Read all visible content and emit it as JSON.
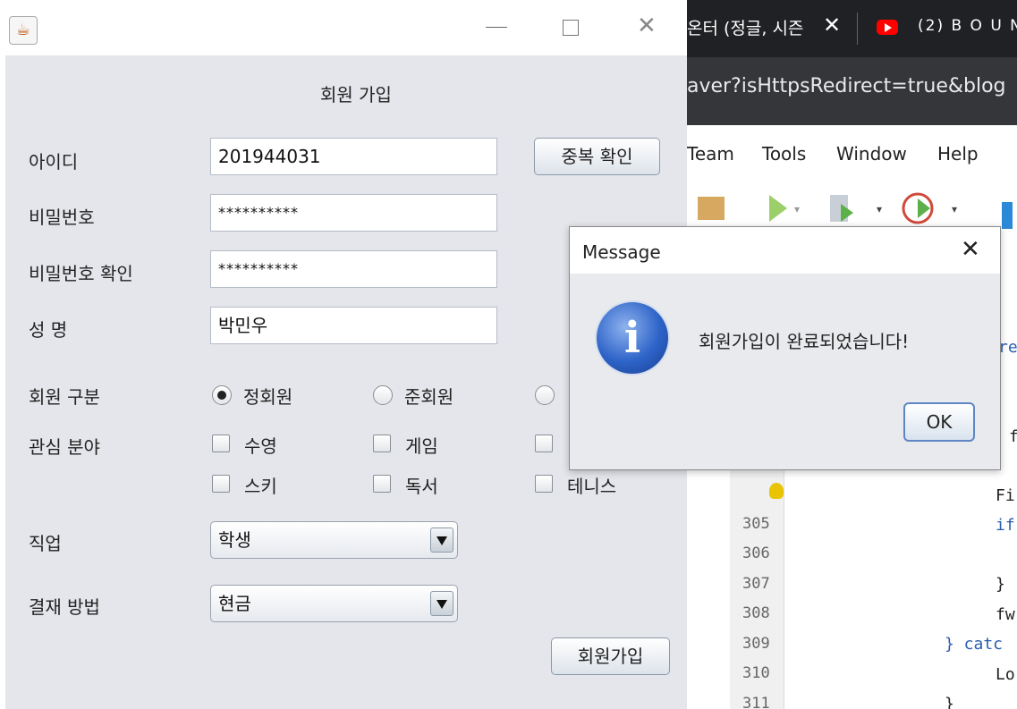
{
  "background": {
    "tab1_title": "온터 (정글, 시즌",
    "tab2_title": "(2) B O U N",
    "url": "aver?isHttpsRedirect=true&blog",
    "menu": [
      "Team",
      "Tools",
      "Window",
      "Help"
    ],
    "line_numbers": [
      "305",
      "306",
      "307",
      "308",
      "309",
      "310",
      "311"
    ],
    "code": {
      "c1": "re",
      "c2": "f",
      "c3": "Fi",
      "c4": "if",
      "c5": "}",
      "c6": "fw",
      "c7": "} catc",
      "c8": "Lo",
      "c9": "}"
    }
  },
  "form": {
    "title": "회원 가입",
    "id_label": "아이디",
    "id_value": "201944031",
    "dup_button": "중복 확인",
    "pw_label": "비밀번호",
    "pw_value": "**********",
    "pw_confirm_label": "비밀번호 확인",
    "pw_confirm_value": "**********",
    "name_label": "성 명",
    "name_value": "박민우",
    "member_type_label": "회원 구분",
    "member_types": [
      "정회원",
      "준회원"
    ],
    "member_type_selected": "정회원",
    "interest_label": "관심 분야",
    "interests": [
      "수영",
      "게임",
      "스키",
      "독서",
      "테니스"
    ],
    "job_label": "직업",
    "job_value": "학생",
    "payment_label": "결재 방법",
    "payment_value": "현금",
    "submit_button": "회원가입"
  },
  "dialog": {
    "title": "Message",
    "message": "회원가입이 완료되었습니다!",
    "ok_button": "OK",
    "icon_glyph": "i"
  }
}
